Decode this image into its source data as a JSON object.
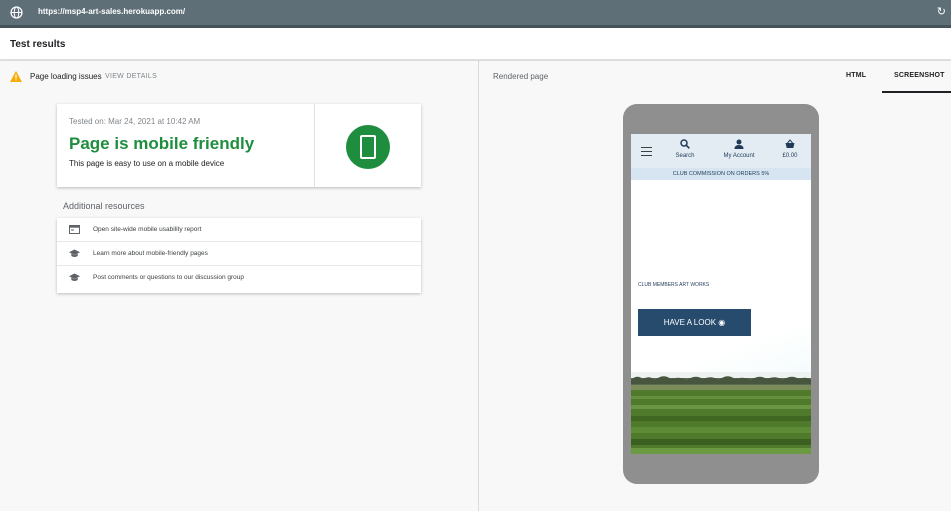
{
  "browser": {
    "url": "https://msp4-art-sales.herokuapp.com/"
  },
  "header": {
    "title": "Test results"
  },
  "left": {
    "issues_label": "Page loading issues",
    "view_details": "VIEW DETAILS",
    "result_card": {
      "tested_on": "Tested on: Mar 24, 2021 at 10:42 AM",
      "verdict": "Page is mobile friendly",
      "description": "This page is easy to use on a mobile device",
      "status_color": "#1e8e3e"
    },
    "resources_title": "Additional resources",
    "resources": [
      {
        "label": "Open site-wide mobile usability report",
        "icon": "report-icon"
      },
      {
        "label": "Learn more about mobile-friendly pages",
        "icon": "graduation-cap-icon"
      },
      {
        "label": "Post comments or questions to our discussion group",
        "icon": "graduation-cap-icon"
      }
    ]
  },
  "right": {
    "rendered_label": "Rendered page",
    "tabs": [
      {
        "label": "HTML",
        "selected": false
      },
      {
        "label": "SCREENSHOT",
        "selected": true
      }
    ],
    "site": {
      "nav": {
        "search": "Search",
        "account": "My Account",
        "bag": "£0.00"
      },
      "promo": "CLUB COMMISSION ON ORDERS 5%",
      "hero_text": "CLUB MEMBERS ART WORKS",
      "cta": "HAVE A LOOK",
      "accent": "#274b6d"
    }
  }
}
